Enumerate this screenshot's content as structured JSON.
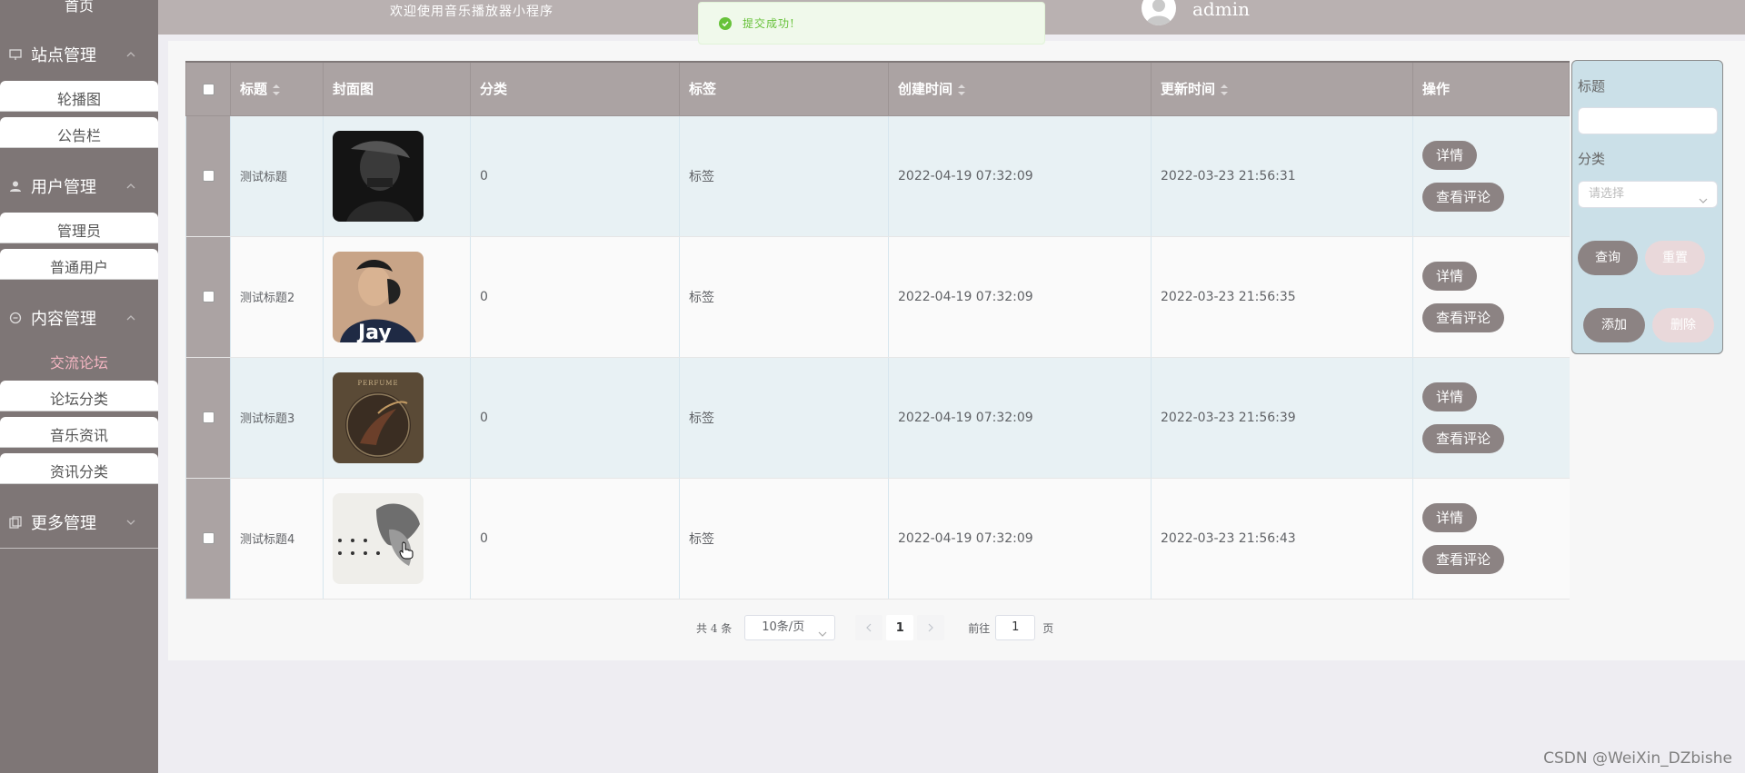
{
  "sidebar": {
    "home": "首页",
    "groups": [
      {
        "label": "站点管理",
        "items": [
          "轮播图",
          "公告栏"
        ]
      },
      {
        "label": "用户管理",
        "items": [
          "管理员",
          "普通用户"
        ]
      },
      {
        "label": "内容管理",
        "items": [
          "交流论坛",
          "论坛分类",
          "音乐资讯",
          "资讯分类"
        ]
      },
      {
        "label": "更多管理",
        "items": []
      }
    ],
    "active_item": "交流论坛",
    "active_color": "#f4b6c2"
  },
  "header": {
    "welcome": "欢迎使用音乐播放器小程序",
    "username": "admin"
  },
  "toast": {
    "message": "提交成功!",
    "color": "#67c23a"
  },
  "table": {
    "columns": [
      "标题",
      "封面图",
      "分类",
      "标签",
      "创建时间",
      "更新时间",
      "操作"
    ],
    "rows": [
      {
        "title": "测试标题",
        "category": "0",
        "tag": "标签",
        "created": "2022-04-19 07:32:09",
        "updated": "2022-03-23 21:56:31",
        "cover_text": ""
      },
      {
        "title": "测试标题2",
        "category": "0",
        "tag": "标签",
        "created": "2022-04-19 07:32:09",
        "updated": "2022-03-23 21:56:35",
        "cover_text": "Jay"
      },
      {
        "title": "测试标题3",
        "category": "0",
        "tag": "标签",
        "created": "2022-04-19 07:32:09",
        "updated": "2022-03-23 21:56:39",
        "cover_text": "PERFUME"
      },
      {
        "title": "测试标题4",
        "category": "0",
        "tag": "标签",
        "created": "2022-04-19 07:32:09",
        "updated": "2022-03-23 21:56:43",
        "cover_text": ""
      }
    ],
    "detail_label": "详情",
    "comments_label": "查看评论"
  },
  "search": {
    "title_label": "标题",
    "category_label": "分类",
    "category_placeholder": "请选择",
    "query_label": "查询",
    "reset_label": "重置",
    "add_label": "添加",
    "delete_label": "删除"
  },
  "pagination": {
    "total": "共 4 条",
    "page_size": "10条/页",
    "current_page": "1",
    "goto_label": "前往",
    "goto_value": "1",
    "page_suffix": "页"
  },
  "watermark": "CSDN @WeiXin_DZbishe",
  "colors": {
    "sidebar_bg": "#7e7676",
    "header_bg": "#b9b1b1",
    "table_header_bg": "#aba3a3",
    "button_bg": "#8c8383",
    "search_panel_bg": "#cbe0e8"
  }
}
